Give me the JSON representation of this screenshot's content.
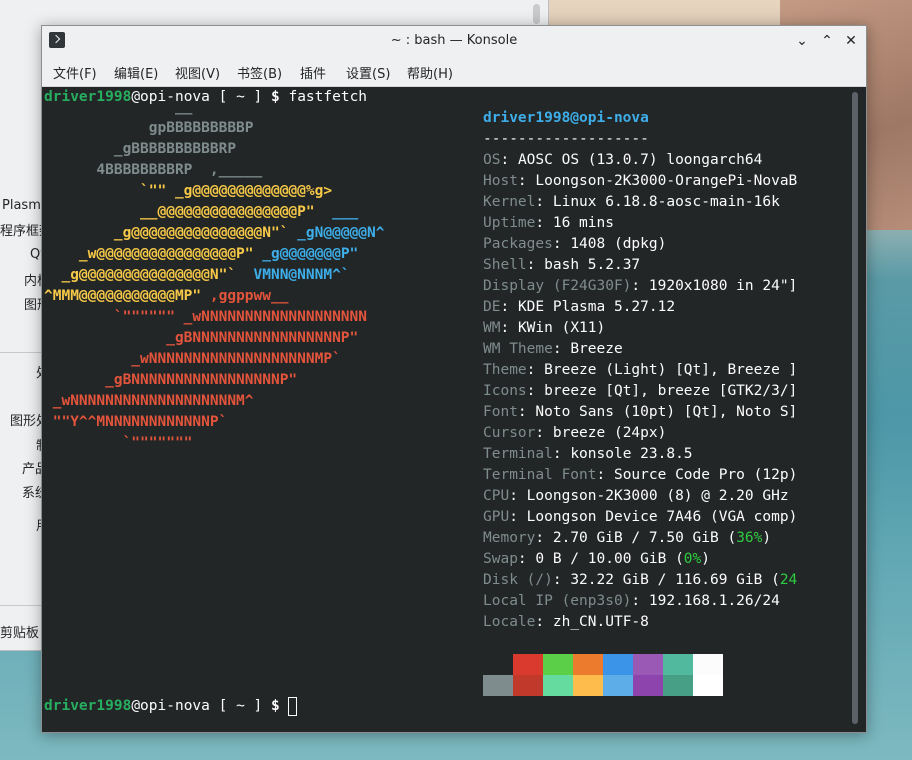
{
  "background_window": {
    "labels": [
      "Plasma",
      "程序框架",
      "Qt",
      "内核",
      "图形",
      "处",
      "图形处",
      "制",
      "产品",
      "系统",
      "用",
      "剪贴板"
    ]
  },
  "window": {
    "title": "~ : bash — Konsole",
    "buttons": {
      "minimize": "⌄",
      "maximize": "⌃",
      "close": "✕"
    }
  },
  "menu": [
    "文件(F)",
    "编辑(E)",
    "视图(V)",
    "书签(B)",
    "插件",
    "设置(S)",
    "帮助(H)"
  ],
  "terminal": {
    "prompt_user": "driver1998",
    "prompt_host": "@opi-nova",
    "prompt_path": " [ ~ ] ",
    "prompt_symbol": "$",
    "command": "fastfetch",
    "logo_lines": [
      {
        "text": "               __",
        "color": "gray"
      },
      {
        "text": "            gpBBBBBBBBBP",
        "color": "gray"
      },
      {
        "text": "        _gBBBBBBBBBBRP",
        "color": "gray"
      },
      {
        "text": "      4BBBBBBBBRP  ,_____",
        "color": "gray"
      },
      {
        "text": "           `\"\" _g@@@@@@@@@@@@@%g>",
        "color": "yellow"
      },
      {
        "text": "           __@@@@@@@@@@@@@@@@P\"  ___",
        "color": "yellow"
      },
      {
        "text": "        _g@@@@@@@@@@@@@@@N\"` _gN@@@@@N^",
        "color": "yellow"
      },
      {
        "text": "    _w@@@@@@@@@@@@@@@@P\" _g@@@@@@@P\"",
        "color": "yellow"
      },
      {
        "text": "  _g@@@@@@@@@@@@@@@N\"`  VMNN@NNNM^`",
        "color": "yellow"
      },
      {
        "text": "^MMM@@@@@@@@@@@MP\" ,ggppww__",
        "color": "yellow"
      },
      {
        "text": "        `\"\"\"\"\"\" _wNNNNNNNNNNNNNNNNNNN",
        "color": "red"
      },
      {
        "text": "              _gBNNNNNNNNNNNNNNNNNP\"",
        "color": "red"
      },
      {
        "text": "          _wNNNNNNNNNNNNNNNNNNNMP`",
        "color": "red"
      },
      {
        "text": "       _gBNNNNNNNNNNNNNNNNNP\"",
        "color": "red"
      },
      {
        "text": " _wNNNNNNNNNNNNNNNNNNNM^",
        "color": "red"
      },
      {
        "text": " \"\"Y^^MNNNNNNNNNNNNP`",
        "color": "red"
      },
      {
        "text": "         `\"\"\"\"\"\"\"",
        "color": "red"
      }
    ],
    "info_header": "driver1998@opi-nova",
    "separator": "-------------------",
    "info": [
      {
        "key": "OS",
        "value": "AOSC OS (13.0.7) loongarch64"
      },
      {
        "key": "Host",
        "value": "Loongson-2K3000-OrangePi-NovaB"
      },
      {
        "key": "Kernel",
        "value": "Linux 6.18.8-aosc-main-16k"
      },
      {
        "key": "Uptime",
        "value": "16 mins"
      },
      {
        "key": "Packages",
        "value": "1408 (dpkg)"
      },
      {
        "key": "Shell",
        "value": "bash 5.2.37"
      },
      {
        "key": "Display (F24G30F)",
        "value": "1920x1080 in 24\"]"
      },
      {
        "key": "DE",
        "value": "KDE Plasma 5.27.12"
      },
      {
        "key": "WM",
        "value": "KWin (X11)"
      },
      {
        "key": "WM Theme",
        "value": "Breeze"
      },
      {
        "key": "Theme",
        "value": "Breeze (Light) [Qt], Breeze ]"
      },
      {
        "key": "Icons",
        "value": "breeze [Qt], breeze [GTK2/3/]"
      },
      {
        "key": "Font",
        "value": "Noto Sans (10pt) [Qt], Noto S]"
      },
      {
        "key": "Cursor",
        "value": "breeze (24px)"
      },
      {
        "key": "Terminal",
        "value": "konsole 23.8.5"
      },
      {
        "key": "Terminal Font",
        "value": "Source Code Pro (12p)"
      },
      {
        "key": "CPU",
        "value": "Loongson-2K3000 (8) @ 2.20 GHz"
      },
      {
        "key": "GPU",
        "value": "Loongson Device 7A46 (VGA comp)"
      },
      {
        "key": "Memory",
        "value": "2.70 GiB / 7.50 GiB (",
        "pct": "36%",
        "tail": ")"
      },
      {
        "key": "Swap",
        "value": "0 B / 10.00 GiB (",
        "pct": "0%",
        "tail": ")"
      },
      {
        "key": "Disk (/)",
        "value": "32.22 GiB / 116.69 GiB (",
        "pct": "24",
        "tail": ""
      },
      {
        "key": "Local IP (enp3s0)",
        "value": "192.168.1.26/24"
      },
      {
        "key": "Locale",
        "value": "zh_CN.UTF-8"
      }
    ],
    "palette_top": [
      "#232627",
      "#da3a2d",
      "#5bcf47",
      "#ed7b2d",
      "#3c94e8",
      "#9b59b6",
      "#51b99d",
      "#fcfcfc"
    ],
    "palette_bottom": [
      "#7f8c8d",
      "#c0392b",
      "#66dba0",
      "#fdbc4b",
      "#5cade8",
      "#8e44ad",
      "#47a086",
      "#ffffff"
    ]
  }
}
